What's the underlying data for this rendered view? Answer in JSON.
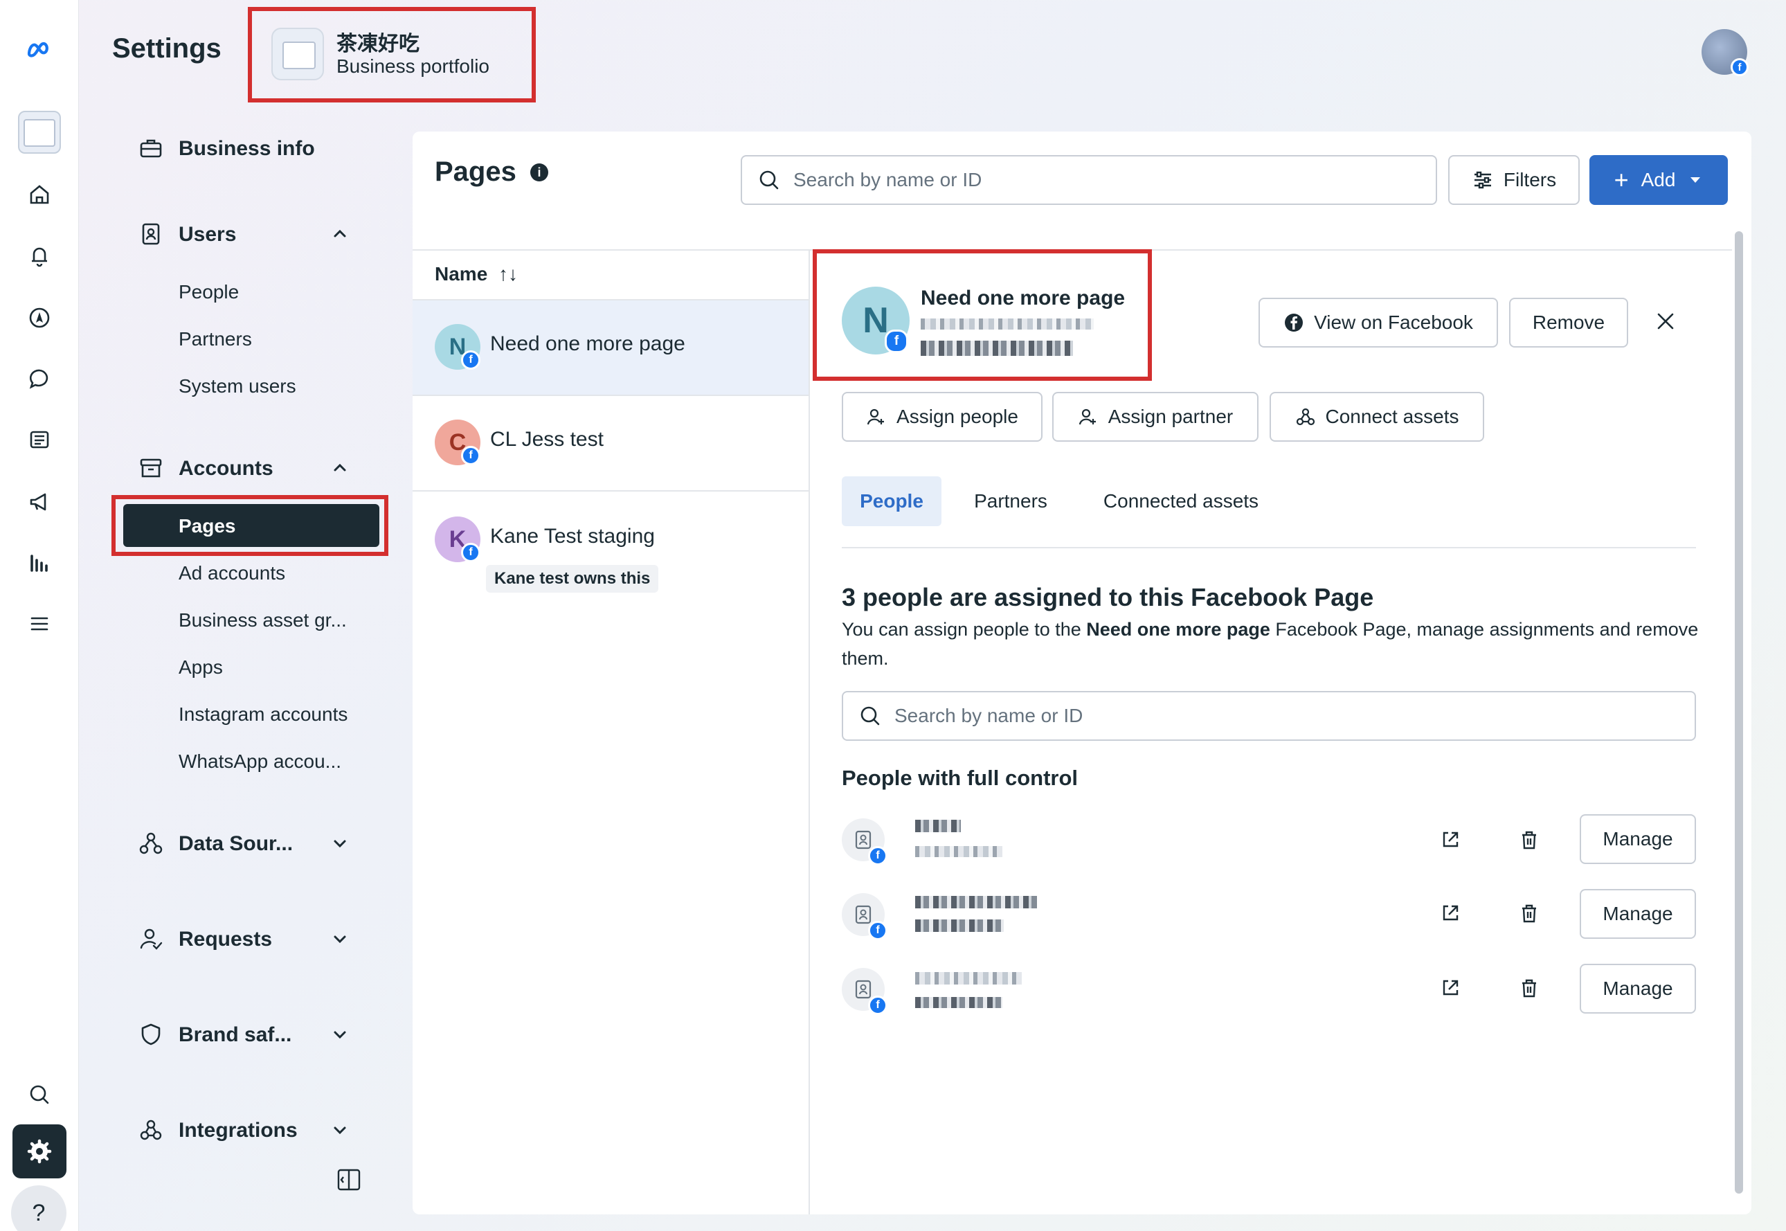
{
  "header": {
    "title": "Settings",
    "portfolio_name": "茶凍好吃",
    "portfolio_sub": "Business portfolio"
  },
  "sidebar": {
    "business_info": "Business info",
    "users": {
      "label": "Users",
      "items": [
        "People",
        "Partners",
        "System users"
      ]
    },
    "accounts": {
      "label": "Accounts",
      "selected": "Pages",
      "items": [
        "Ad accounts",
        "Business asset gr...",
        "Apps",
        "Instagram accounts",
        "WhatsApp accou..."
      ]
    },
    "data_sources": "Data Sour...",
    "requests": "Requests",
    "brand_safety": "Brand saf...",
    "integrations": "Integrations"
  },
  "main": {
    "title": "Pages",
    "search_placeholder": "Search by name or ID",
    "filters_label": "Filters",
    "add_label": "Add",
    "column_name": "Name",
    "sort_glyph": "↑↓"
  },
  "pages_list": [
    {
      "initial": "N",
      "name": "Need one more page",
      "color": "#a9d9e4",
      "text_color": "#2a6f86"
    },
    {
      "initial": "C",
      "name": "CL Jess test",
      "color": "#f0a79b",
      "text_color": "#9b3324"
    },
    {
      "initial": "K",
      "name": "Kane Test staging",
      "color": "#d3b6ea",
      "text_color": "#6a3e91",
      "owner_note": "Kane test owns this"
    }
  ],
  "detail": {
    "initial": "N",
    "name": "Need one more page",
    "view_on_facebook": "View on Facebook",
    "remove": "Remove",
    "assign_people": "Assign people",
    "assign_partner": "Assign partner",
    "connect_assets": "Connect assets",
    "tabs": [
      "People",
      "Partners",
      "Connected assets"
    ],
    "section_title": "3 people are assigned to this Facebook Page",
    "desc_prefix": "You can assign people to the ",
    "desc_bold": "Need one more page",
    "desc_suffix": " Facebook Page, manage assignments and remove them.",
    "search_placeholder": "Search by name or ID",
    "full_control_title": "People with full control",
    "manage_label": "Manage"
  },
  "colors": {
    "accent": "#2e6cc7",
    "highlight_box": "#d32f2f",
    "facebook_blue": "#1877f2"
  }
}
